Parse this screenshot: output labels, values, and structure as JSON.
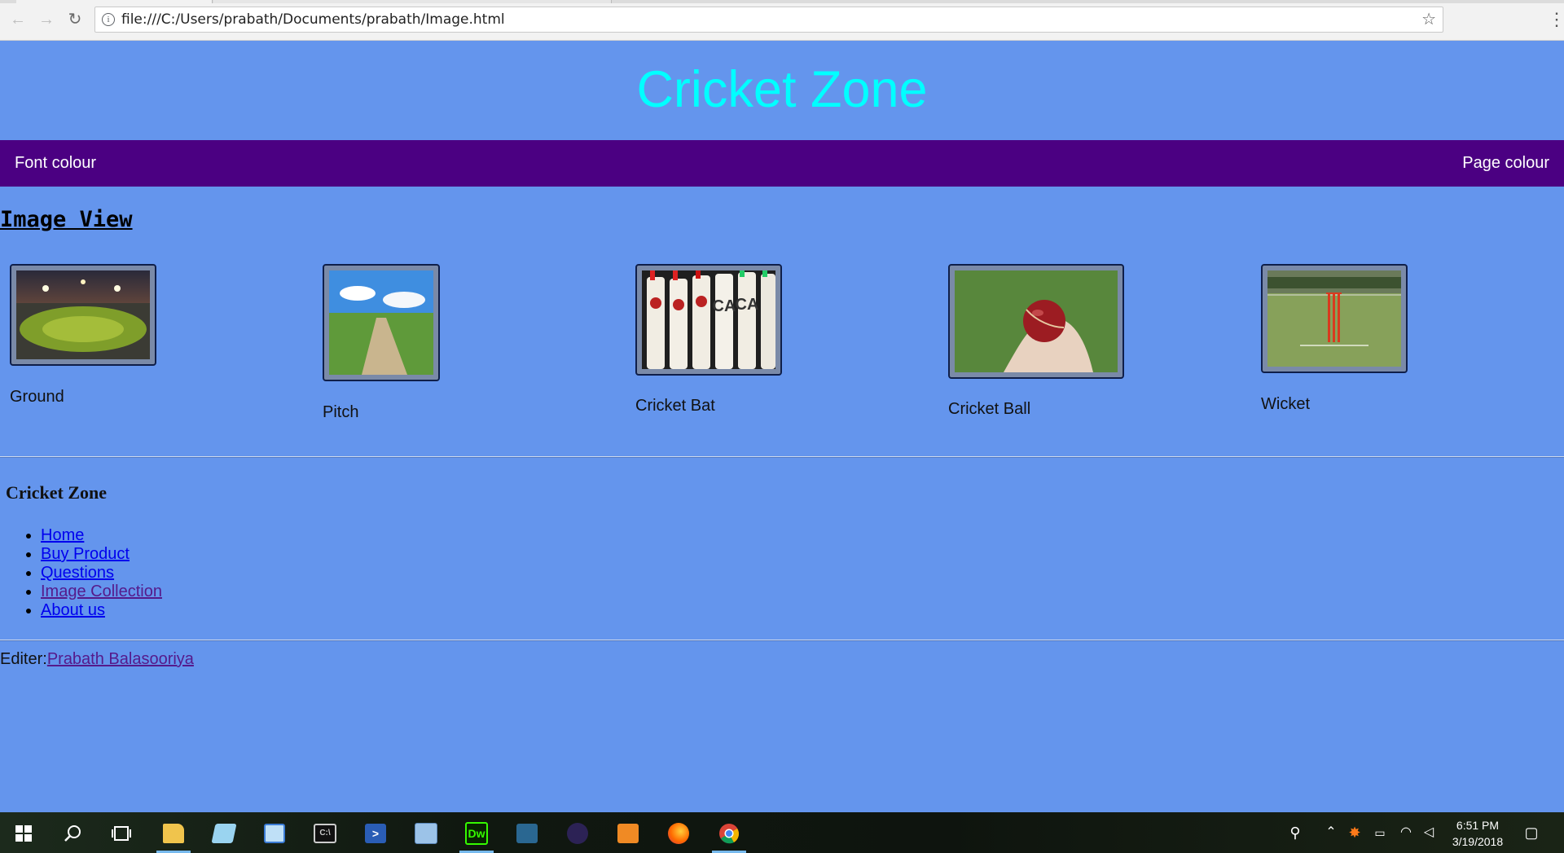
{
  "browser": {
    "url": "file:///C:/Users/prabath/Documents/prabath/Image.html",
    "back_icon": "←",
    "forward_icon": "→",
    "reload_icon": "↻",
    "star_icon": "☆",
    "menu_icon": "⋮"
  },
  "page": {
    "background_color": "#6495ED",
    "site_title": "Cricket Zone",
    "site_title_color": "#00FFFF",
    "nav": {
      "background_color": "#4B0082",
      "left_label": "Font colour",
      "right_label": "Page colour"
    },
    "section_title": "Image View",
    "gallery": [
      {
        "caption": "Ground",
        "icon": "stadium-photo"
      },
      {
        "caption": "Pitch",
        "icon": "pitch-photo"
      },
      {
        "caption": "Cricket Bat",
        "icon": "cricket-bats-photo"
      },
      {
        "caption": "Cricket Ball",
        "icon": "cricket-ball-photo"
      },
      {
        "caption": "Wicket",
        "icon": "wicket-photo"
      }
    ],
    "footer": {
      "title": "Cricket Zone",
      "links": [
        "Home",
        "Buy Product",
        "Questions",
        "Image Collection",
        "About us"
      ],
      "editor_label": "Editer:",
      "editor_name": "Prabath Balasooriya"
    }
  },
  "taskbar": {
    "time": "6:51 PM",
    "date": "3/19/2018",
    "apps": [
      "start",
      "search",
      "task-view",
      "file-explorer",
      "notepad",
      "paint",
      "cmd",
      "powershell",
      "virtualbox",
      "dreamweaver",
      "mysql-workbench",
      "eclipse",
      "media-player",
      "firefox",
      "chrome"
    ]
  }
}
